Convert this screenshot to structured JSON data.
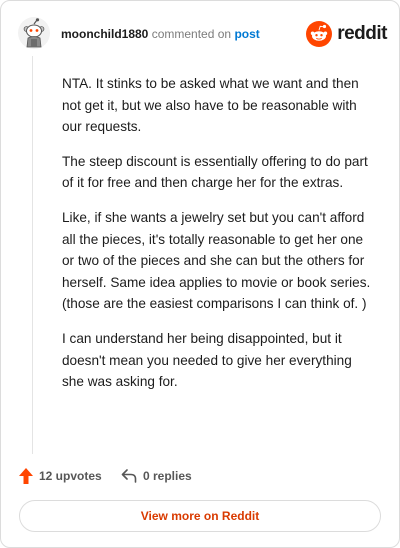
{
  "header": {
    "author": "moonchild1880",
    "commented_text": "commented on",
    "post_link": "post",
    "brand": "reddit"
  },
  "comment": {
    "paragraphs": [
      "NTA. It stinks to be asked what we want and then not get it, but we also have to be reasonable with our requests.",
      "The steep discount is essentially offering to do part of it for free and then charge her for the extras.",
      "Like, if she wants a jewelry set but you can't afford all the pieces, it's totally reasonable to get her one or two of the pieces and she can but the others for herself. Same idea applies to movie or book series.(those are the easiest comparisons I can think of. )",
      "I can understand her being disappointed, but it doesn't mean you needed to give her everything she was asking for."
    ]
  },
  "actions": {
    "upvotes_label": "12 upvotes",
    "replies_label": "0 replies"
  },
  "footer": {
    "view_more_label": "View more on Reddit"
  },
  "colors": {
    "upvote": "#ff4500",
    "link": "#0079d3",
    "view_more": "#d93a00",
    "brand": "#ff4500"
  },
  "icons": {
    "avatar": "snoo-avatar-icon",
    "logo": "reddit-logo-icon",
    "upvote": "upvote-arrow-icon",
    "reply": "reply-arrow-icon"
  }
}
